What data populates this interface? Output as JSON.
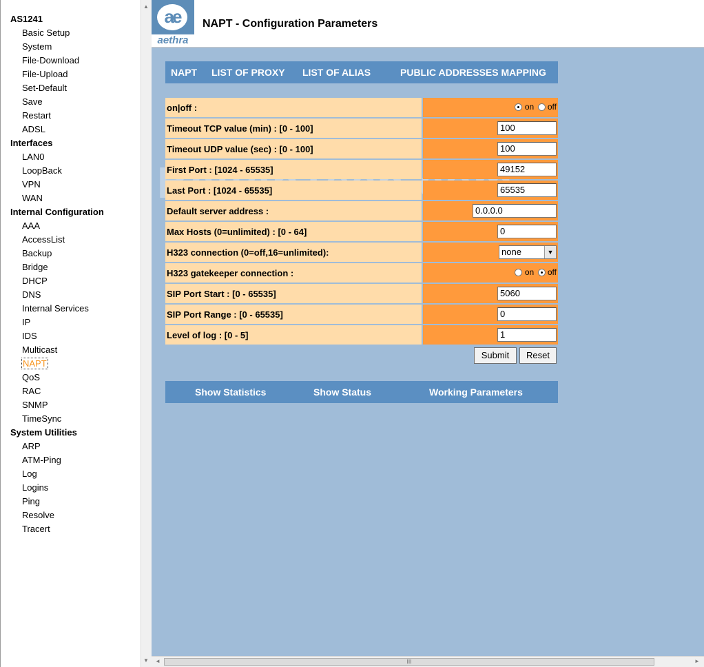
{
  "sidebar": {
    "groups": [
      {
        "title": "AS1241",
        "items": [
          "Basic Setup",
          "System",
          "File-Download",
          "File-Upload",
          "Set-Default",
          "Save",
          "Restart",
          "ADSL"
        ]
      },
      {
        "title": "Interfaces",
        "items": [
          "LAN0",
          "LoopBack",
          "VPN",
          "WAN"
        ]
      },
      {
        "title": "Internal Configuration",
        "items": [
          "AAA",
          "AccessList",
          "Backup",
          "Bridge",
          "DHCP",
          "DNS",
          "Internal Services",
          "IP",
          "IDS",
          "Multicast",
          "NAPT",
          "QoS",
          "RAC",
          "SNMP",
          "TimeSync"
        ]
      },
      {
        "title": "System Utilities",
        "items": [
          "ARP",
          "ATM-Ping",
          "Log",
          "Logins",
          "Ping",
          "Resolve",
          "Tracert"
        ]
      }
    ],
    "active": "NAPT"
  },
  "header": {
    "logo_text": "aethra",
    "logo_glyph": "ae",
    "title": "NAPT - Configuration Parameters"
  },
  "tabs": [
    "NAPT",
    "LIST OF PROXY",
    "LIST OF ALIAS",
    "PUBLIC ADDRESSES MAPPING"
  ],
  "form": {
    "rows": [
      {
        "label": "on|off :",
        "type": "radio",
        "on_label": "on",
        "off_label": "off",
        "selected": "on"
      },
      {
        "label": "Timeout TCP value (min) : [0 - 100]",
        "type": "text",
        "value": "100"
      },
      {
        "label": "Timeout UDP value (sec) : [0 - 100]",
        "type": "text",
        "value": "100"
      },
      {
        "label": "First Port : [1024 - 65535]",
        "type": "text",
        "value": "49152"
      },
      {
        "label": "Last Port : [1024 - 65535]",
        "type": "text",
        "value": "65535"
      },
      {
        "label": "Default server address :",
        "type": "text",
        "value": "0.0.0.0",
        "wide": true
      },
      {
        "label": "Max Hosts (0=unlimited) : [0 - 64]",
        "type": "text",
        "value": "0"
      },
      {
        "label": "H323 connection (0=off,16=unlimited):",
        "type": "select",
        "value": "none"
      },
      {
        "label": "H323 gatekeeper connection :",
        "type": "radio",
        "on_label": "on",
        "off_label": "off",
        "selected": "off"
      },
      {
        "label": "SIP Port Start : [0 - 65535]",
        "type": "text",
        "value": "5060"
      },
      {
        "label": "SIP Port Range : [0 - 65535]",
        "type": "text",
        "value": "0"
      },
      {
        "label": "Level of log : [0 - 5]",
        "type": "text",
        "value": "1"
      }
    ],
    "submit_label": "Submit",
    "reset_label": "Reset"
  },
  "bottom_links": [
    "Show Statistics",
    "Show Status",
    "Working Parameters"
  ],
  "watermark": "BaltanTech.com",
  "scrollbar_grip": "III",
  "colors": {
    "tab_bar": "#5b8fc2",
    "label_bg": "#ffdcaa",
    "value_bg": "#ff9a3c",
    "page_bg": "#a0bcd8",
    "active_nav": "#f7941d"
  }
}
